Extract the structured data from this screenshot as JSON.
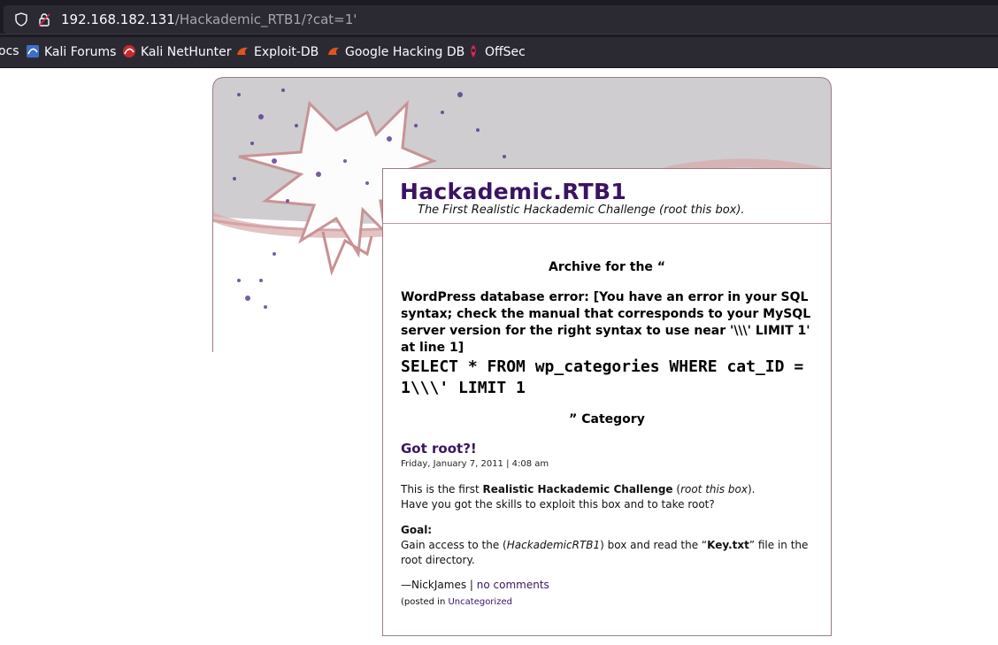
{
  "browser": {
    "url_host": "192.168.182.131",
    "url_path": "/Hackademic_RTB1/?cat=1'",
    "bookmarks": [
      {
        "label": "ocs",
        "icon": "docs-icon"
      },
      {
        "label": "Kali Forums",
        "icon": "kali-forums-icon"
      },
      {
        "label": "Kali NetHunter",
        "icon": "kali-nethunter-icon"
      },
      {
        "label": "Exploit-DB",
        "icon": "exploit-db-icon"
      },
      {
        "label": "Google Hacking DB",
        "icon": "google-hacking-db-icon"
      },
      {
        "label": "OffSec",
        "icon": "offsec-icon"
      }
    ]
  },
  "site": {
    "title": "Hackademic.RTB1",
    "tagline": "The First Realistic Hackademic Challenge (root this box)."
  },
  "archive": {
    "heading": "Archive for the “",
    "db_error": "WordPress database error: [You have an error in your SQL syntax; check the manual that corresponds to your MySQL server version for the right syntax to use near '\\\\\\' LIMIT 1' at line 1]",
    "sql": "SELECT * FROM wp_categories WHERE cat_ID = 1\\\\\\' LIMIT 1",
    "category_suffix": "” Category"
  },
  "post": {
    "title": "Got root?!",
    "date": "Friday, January 7, 2011 | 4:08 am",
    "intro_a": "This is the first ",
    "intro_b": "Realistic Hackademic Challenge",
    "intro_c": " (",
    "intro_d": "root this box",
    "intro_e": ").",
    "intro_line2": "Have you got the skills to exploit this box and to take root?",
    "goal_label": "Goal:",
    "goal_a": "Gain access to the (",
    "goal_b": "HackademicRTB1",
    "goal_c": ") box and read the “",
    "goal_d": "Key.txt",
    "goal_e": "” file in the root directory.",
    "author": "—NickJames | ",
    "comments_link": "no comments",
    "posted_in": "(posted in ",
    "category_link": "Uncategorized"
  },
  "colors": {
    "title_purple": "#3a1463",
    "border_rose": "#9c7b84",
    "chrome_dark": "#1c1b22"
  }
}
